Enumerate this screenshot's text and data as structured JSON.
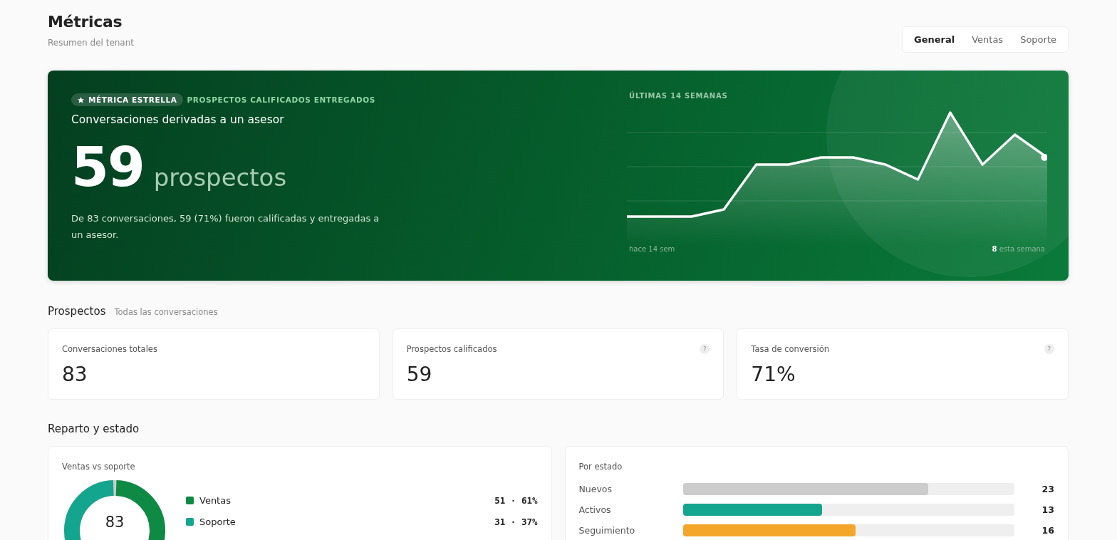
{
  "header": {
    "title": "Métricas",
    "subtitle": "Resumen del tenant"
  },
  "tabs": [
    {
      "label": "General",
      "selected": true
    },
    {
      "label": "Ventas",
      "selected": false
    },
    {
      "label": "Soporte",
      "selected": false
    }
  ],
  "hero": {
    "badge": "MÉTRICA ESTRELLA",
    "eyebrow": "PROSPECTOS CALIFICADOS ENTREGADOS",
    "title": "Conversaciones derivadas a un asesor",
    "value": "59",
    "unit": "prospectos",
    "description": "De 83 conversaciones, 59 (71%) fueron calificadas y entregadas a un asesor.",
    "chart_title": "ÚLTIMAS 14 SEMANAS",
    "start_label": "hace 14 sem",
    "end_value": "8",
    "end_label": "esta semana"
  },
  "prospects": {
    "title": "Prospectos",
    "subtitle": "Todas las conversaciones",
    "cards": [
      {
        "label": "Conversaciones totales",
        "value": "83",
        "help": false
      },
      {
        "label": "Prospectos calificados",
        "value": "59",
        "help": true,
        "help_text": "?"
      },
      {
        "label": "Tasa de conversión",
        "value": "71%",
        "help": true,
        "help_text": "?"
      }
    ]
  },
  "distribution": {
    "title": "Reparto y estado",
    "split": {
      "title": "Ventas vs soporte",
      "total": "83",
      "items": [
        {
          "name": "Ventas",
          "count": "51",
          "separator": "·",
          "percent": "61%",
          "color": "#0f8a45"
        },
        {
          "name": "Soporte",
          "count": "31",
          "separator": "·",
          "percent": "37%",
          "color": "#14a58f"
        }
      ]
    },
    "status": {
      "title": "Por estado",
      "items": [
        {
          "name": "Nuevos",
          "value": "23",
          "color": "#cccccc",
          "level": 0.74
        },
        {
          "name": "Activos",
          "value": "13",
          "color": "#14a58f",
          "level": 0.42
        },
        {
          "name": "Seguimiento",
          "value": "16",
          "color": "#f4a62a",
          "level": 0.52
        }
      ]
    }
  }
}
